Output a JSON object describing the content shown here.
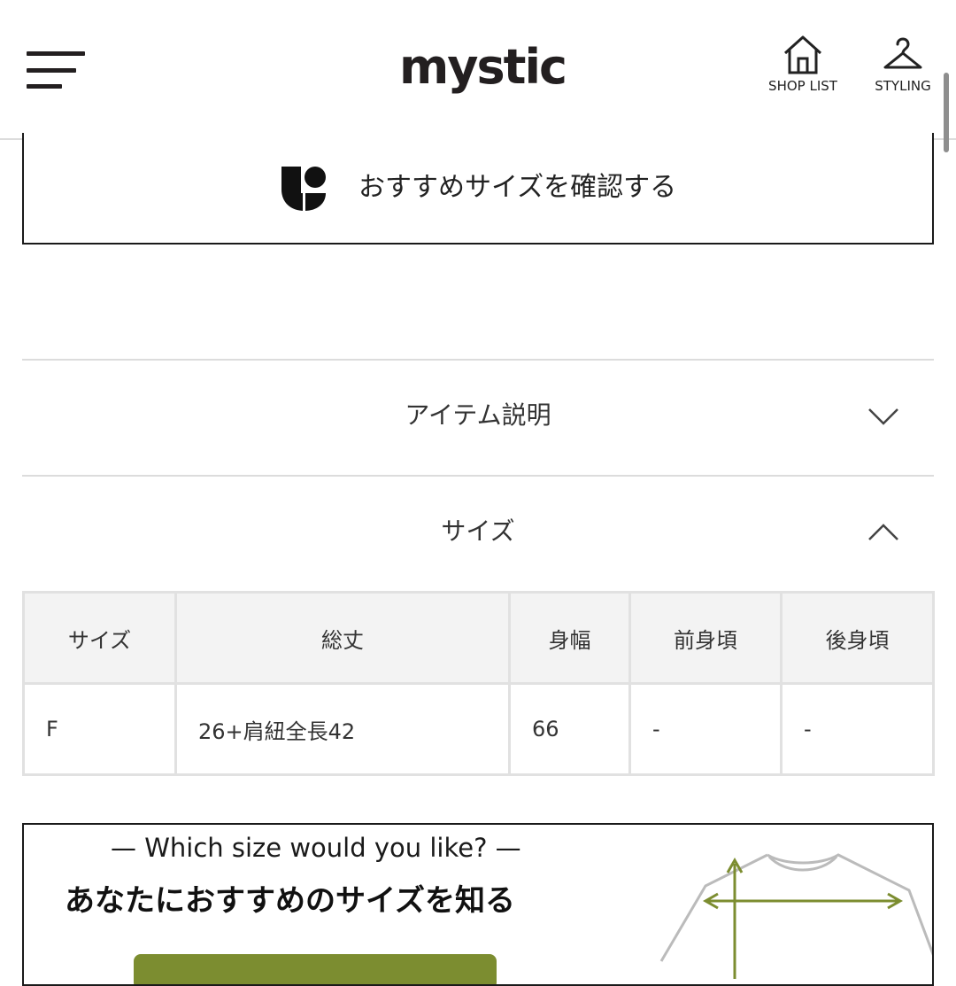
{
  "header": {
    "logo": "mystic",
    "shop_list_label": "SHOP LIST",
    "styling_label": "STYLING"
  },
  "recommend_button": {
    "label": "おすすめサイズを確認する"
  },
  "accordions": [
    {
      "title": "アイテム説明",
      "expanded": false
    },
    {
      "title": "サイズ",
      "expanded": true
    }
  ],
  "size_table": {
    "headers": [
      "サイズ",
      "総丈",
      "身幅",
      "前身頃",
      "後身頃"
    ],
    "rows": [
      [
        "F",
        "26+肩紐全長42",
        "66",
        "-",
        "-"
      ]
    ]
  },
  "banner": {
    "subtitle": "— Which size would you like? —",
    "heading": "あなたにおすすめのサイズを知る",
    "accent_color": "#7c8d30"
  },
  "colors": {
    "border_light": "#dcdcdc",
    "table_header_bg": "#f3f3f3",
    "text_dark": "#231f20"
  }
}
